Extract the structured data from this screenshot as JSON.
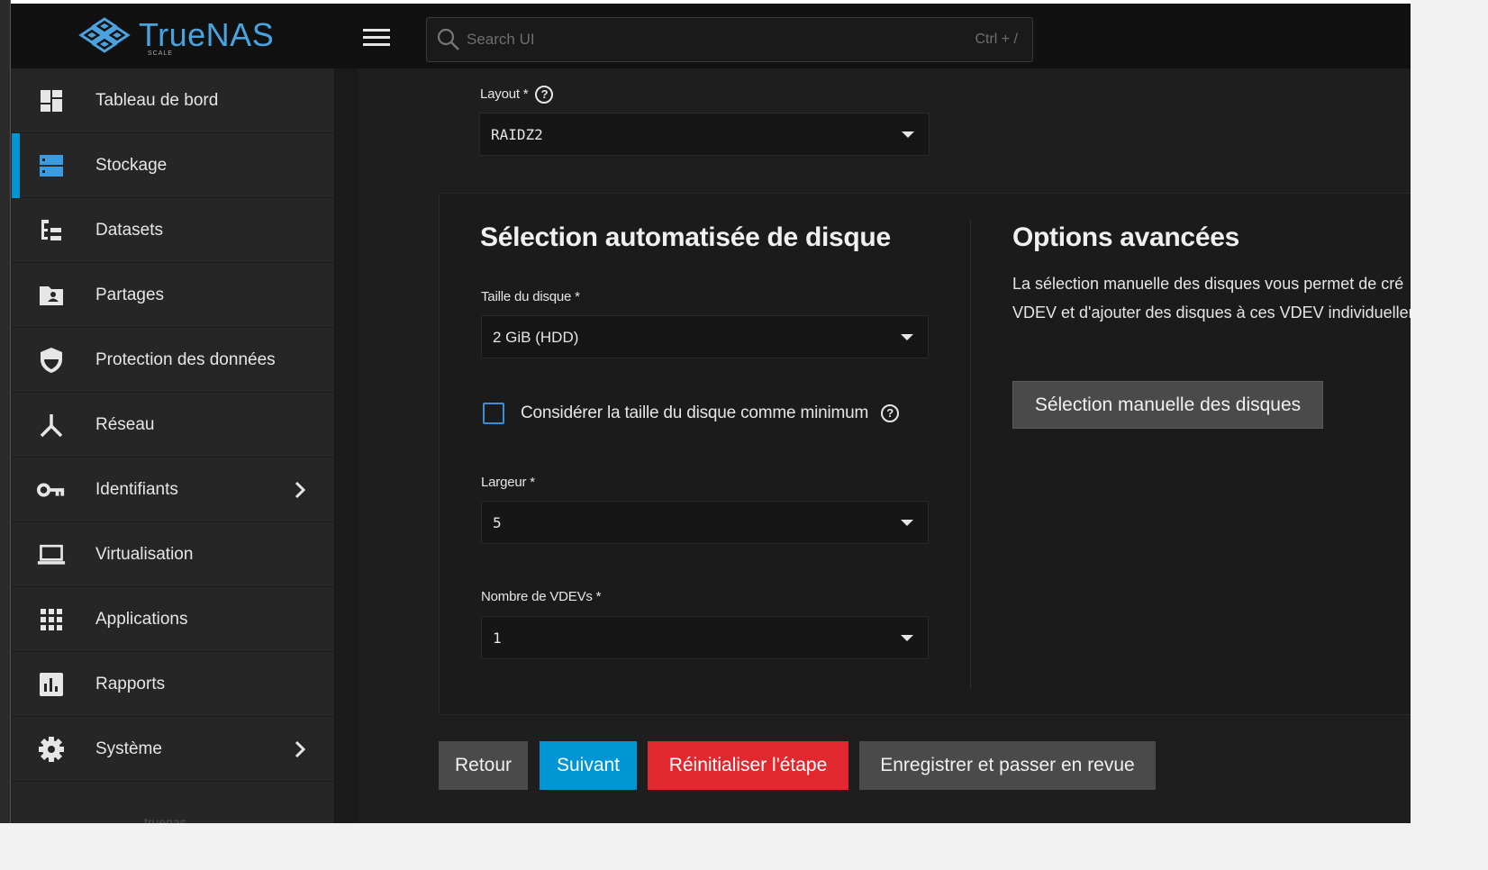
{
  "topbar": {
    "logo_text": "TrueNAS",
    "logo_sub": "SCALE",
    "search_placeholder": "Search UI",
    "search_shortcut": "Ctrl + /"
  },
  "sidebar": {
    "items": [
      {
        "label": "Tableau de bord",
        "icon": "dashboard-icon"
      },
      {
        "label": "Stockage",
        "icon": "storage-icon",
        "active": true
      },
      {
        "label": "Datasets",
        "icon": "datasets-icon"
      },
      {
        "label": "Partages",
        "icon": "shares-folder-icon"
      },
      {
        "label": "Protection des données",
        "icon": "shield-icon"
      },
      {
        "label": "Réseau",
        "icon": "network-icon"
      },
      {
        "label": "Identifiants",
        "icon": "key-icon",
        "chevron": true
      },
      {
        "label": "Virtualisation",
        "icon": "laptop-icon"
      },
      {
        "label": "Applications",
        "icon": "apps-grid-icon"
      },
      {
        "label": "Rapports",
        "icon": "reports-chart-icon"
      },
      {
        "label": "Système",
        "icon": "gear-icon",
        "chevron": true
      }
    ],
    "footer": "truenas"
  },
  "form": {
    "layout_label": "Layout *",
    "layout_value": "RAIDZ2",
    "auto_title": "Sélection automatisée de disque",
    "disk_size_label": "Taille du disque *",
    "disk_size_value": "2 GiB (HDD)",
    "min_checkbox_label": "Considérer la taille du disque comme minimum",
    "width_label": "Largeur *",
    "width_value": "5",
    "vdevs_label": "Nombre de VDEVs *",
    "vdevs_value": "1",
    "advanced_title": "Options avancées",
    "advanced_line1": "La sélection manuelle des disques vous permet de cré",
    "advanced_line2": "VDEV et d'ajouter des disques à ces VDEV individueller",
    "manual_button": "Sélection manuelle des disques"
  },
  "actions": {
    "back": "Retour",
    "next": "Suivant",
    "reset": "Réinitialiser l'étape",
    "save_review": "Enregistrer et passer en revue"
  },
  "colors": {
    "accent": "#0095d5",
    "danger": "#e0282e",
    "neutral_button": "#4a4a4a"
  }
}
